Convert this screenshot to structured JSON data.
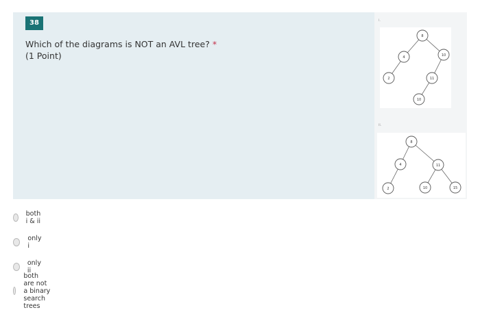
{
  "question": {
    "number": "38",
    "text": "Which of the diagrams is NOT an AVL tree?",
    "required_mark": "*",
    "points": "(1 Point)"
  },
  "diagrams": [
    {
      "label": "i.",
      "nodes": [
        "8",
        "4",
        "10",
        "2",
        "11",
        "10"
      ]
    },
    {
      "label": "ii.",
      "nodes": [
        "8",
        "4",
        "11",
        "2",
        "10",
        "15"
      ]
    }
  ],
  "options": [
    {
      "label": "both i & ii"
    },
    {
      "label": "only i"
    },
    {
      "label": "only ii"
    },
    {
      "label": "both are not a binary search trees"
    }
  ],
  "colors": {
    "badge": "#1a7375",
    "card_bg": "#e5eef2",
    "required": "#c4314b"
  }
}
